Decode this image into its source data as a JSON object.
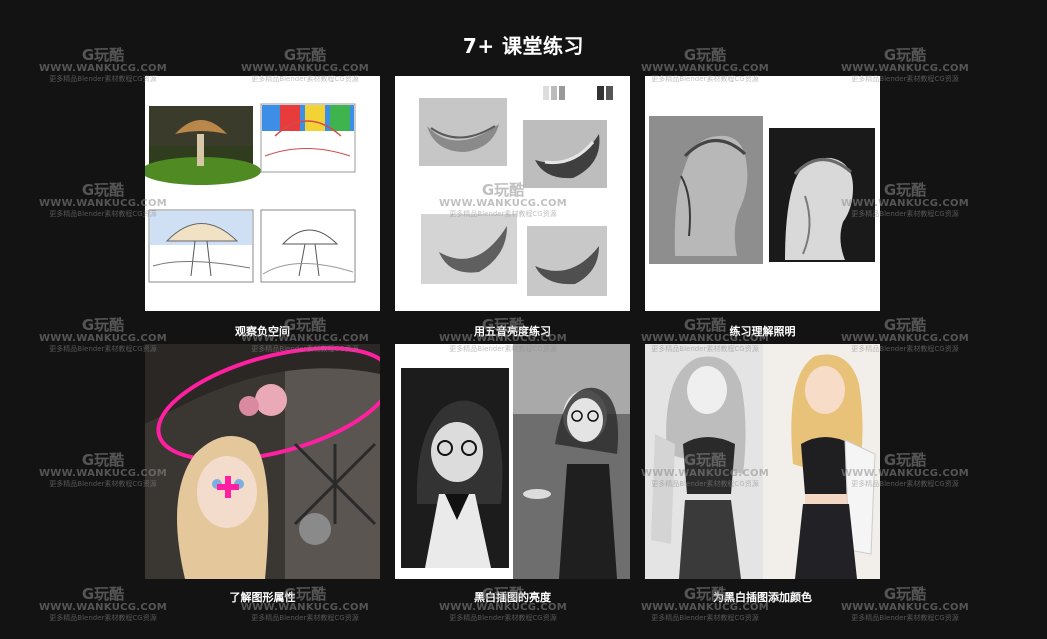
{
  "page": {
    "title": "7+ 课堂练习"
  },
  "watermark": {
    "logo": "G玩酷",
    "url": "WWW.WANKUCG.COM",
    "tagline": "更多精品Blender素材教程CG资源"
  },
  "cards": [
    {
      "caption": "观察负空间",
      "image_icon": "mushroom-sketch-image"
    },
    {
      "caption": "用五音亮度练习",
      "image_icon": "banana-value-study-image"
    },
    {
      "caption": "练习理解照明",
      "image_icon": "bust-lighting-study-image"
    },
    {
      "caption": "了解图形属性",
      "image_icon": "witch-girl-illustration-image"
    },
    {
      "caption": "黑白插图的亮度",
      "image_icon": "bw-girl-glasses-illustration-image"
    },
    {
      "caption": "为黑白插图添加颜色",
      "image_icon": "girl-coloring-illustration-image"
    }
  ],
  "colors": {
    "background": "#131313",
    "text": "#ffffff",
    "accent_pink": "#ff1fa0"
  }
}
